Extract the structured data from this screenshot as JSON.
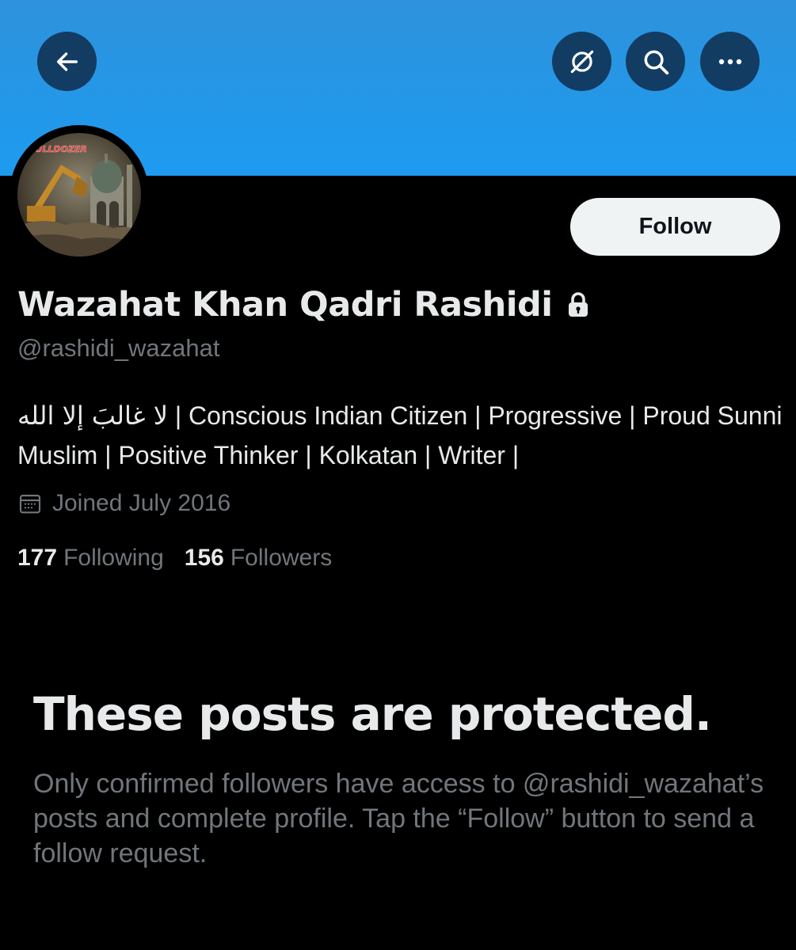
{
  "header": {
    "back_icon": "arrow-left-icon",
    "translate_icon": "translate-globe-slash-icon",
    "search_icon": "search-icon",
    "more_icon": "more-dots-icon",
    "banner_color": "#1d9bf0"
  },
  "avatar": {
    "logo_text": "BULLDOZER"
  },
  "follow_button": {
    "label": "Follow"
  },
  "profile": {
    "display_name": "Wazahat Khan Qadri Rashidi",
    "lock_icon": "lock-icon",
    "handle": "@rashidi_wazahat",
    "bio_arabic": "لا غالبَ إلا الله",
    "bio_text": " | Conscious Indian Citizen | Progressive | Proud Sunni Muslim | Positive Thinker | Kolkatan | Writer |",
    "calendar_icon": "calendar-icon",
    "joined": "Joined July 2016",
    "following_count": "177",
    "following_label": "Following",
    "followers_count": "156",
    "followers_label": "Followers"
  },
  "protected": {
    "title": "These posts are protected.",
    "body": "Only confirmed followers have access to @rashidi_wazahat’s posts and complete profile. Tap the “Follow” button to send a follow request."
  }
}
